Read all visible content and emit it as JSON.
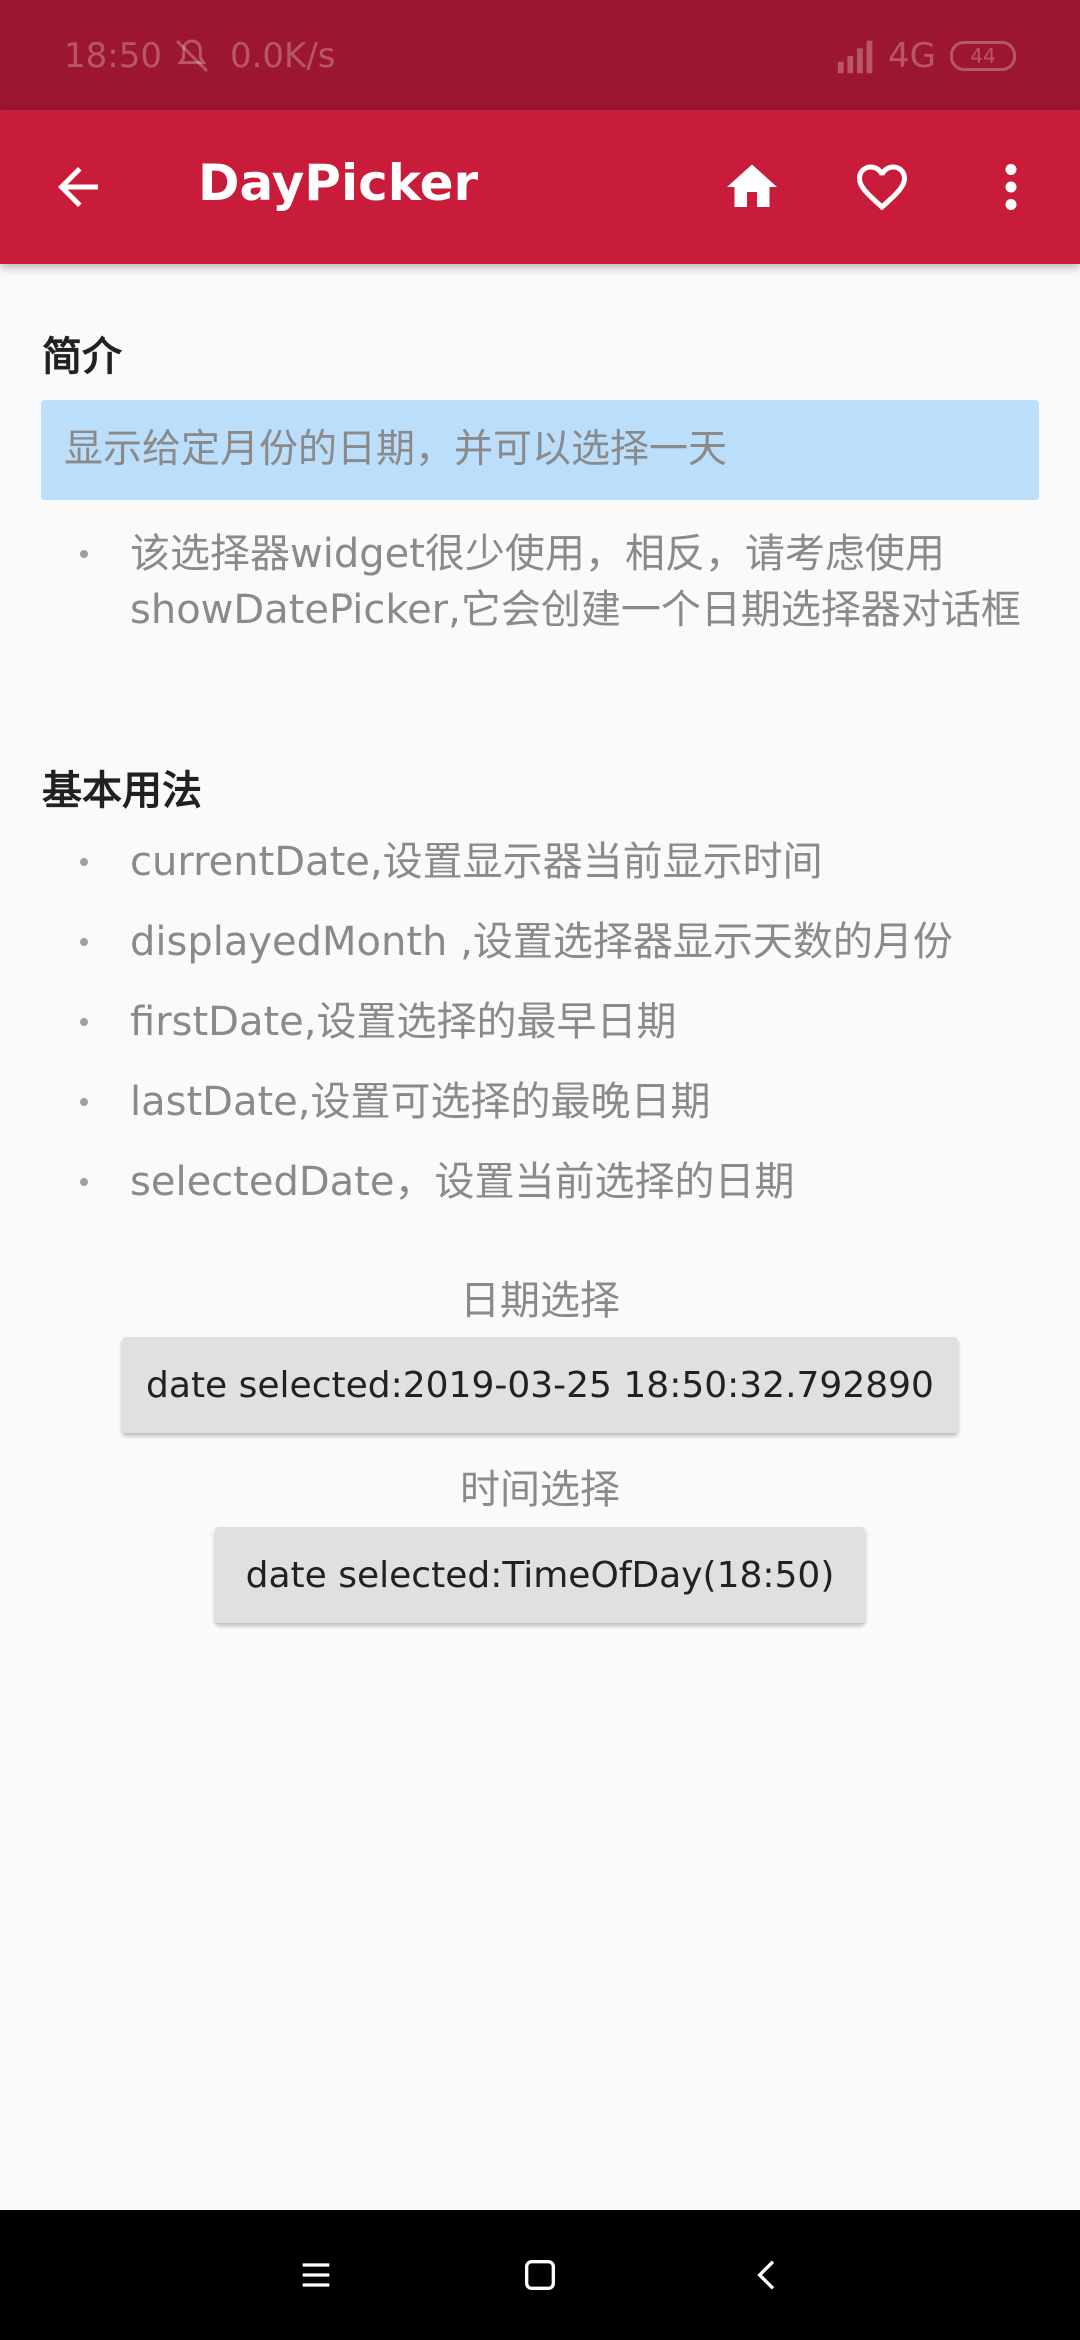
{
  "status_bar": {
    "time": "18:50",
    "speed": "0.0K/s",
    "network": "4G",
    "battery": "44"
  },
  "app_bar": {
    "title": "DayPicker",
    "icons": [
      "back-arrow-icon",
      "home-icon",
      "heart-icon",
      "more-vert-icon"
    ]
  },
  "intro": {
    "heading": "简介",
    "highlight": "显示给定月份的日期，并可以选择一天",
    "note": "该选择器widget很少使用，相反，请考虑使用showDatePicker,它会创建一个日期选择器对话框"
  },
  "usage": {
    "heading": "基本用法",
    "items": [
      "currentDate,设置显示器当前显示时间",
      "displayedMonth ,设置选择器显示天数的月份",
      "firstDate,设置选择的最早日期",
      "lastDate,设置可选择的最晚日期",
      "selectedDate，设置当前选择的日期"
    ]
  },
  "date_picker": {
    "label": "日期选择",
    "button": "date selected:2019-03-25 18:50:32.792890"
  },
  "time_picker": {
    "label": "时间选择",
    "button": "date selected:TimeOfDay(18:50)"
  },
  "nav_bar": {
    "icons": [
      "menu-icon",
      "home-square-icon",
      "back-chevron-icon"
    ]
  },
  "colors": {
    "status_bar": "#9b162e",
    "app_bar": "#c91c3b",
    "intro_box": "#bbdefb",
    "button": "#e0e0e0"
  }
}
